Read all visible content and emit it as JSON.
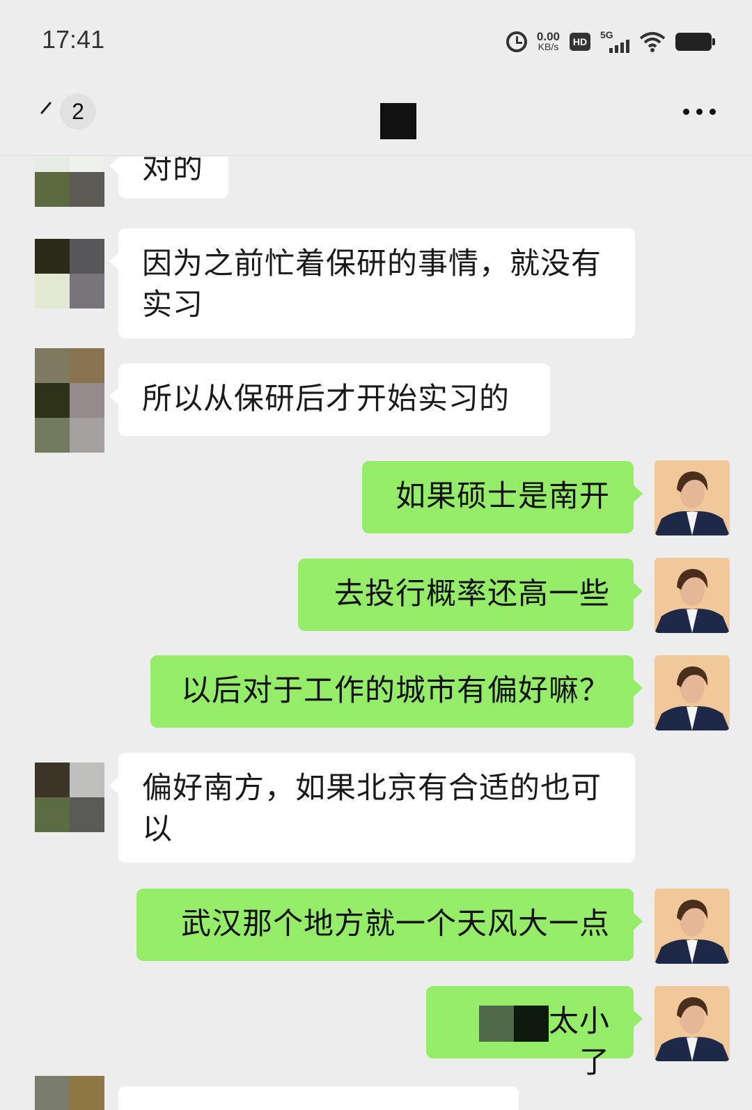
{
  "status_bar": {
    "time": "17:41",
    "net_speed_value": "0.00",
    "net_speed_unit": "KB/s",
    "hd_label": "HD",
    "network_label": "5G"
  },
  "nav": {
    "unread_count": "2"
  },
  "colors": {
    "background": "#ededed",
    "incoming_bubble": "#ffffff",
    "outgoing_bubble": "#95ec69"
  },
  "messages": [
    {
      "side": "in",
      "text": "对的"
    },
    {
      "side": "in",
      "text": "因为之前忙着保研的事情，就没有实习"
    },
    {
      "side": "in",
      "text": "所以从保研后才开始实习的"
    },
    {
      "side": "out",
      "text": "如果硕士是南开"
    },
    {
      "side": "out",
      "text": "去投行概率还高一些"
    },
    {
      "side": "out",
      "text": "以后对于工作的城市有偏好嘛？"
    },
    {
      "side": "in",
      "text": "偏好南方，如果北京有合适的也可以"
    },
    {
      "side": "out",
      "text": "武汉那个地方就一个天风大一点"
    },
    {
      "side": "out",
      "text": "太小了"
    }
  ]
}
